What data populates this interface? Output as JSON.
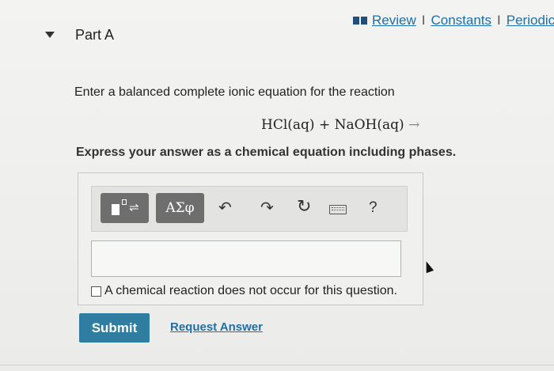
{
  "header": {
    "links": [
      "Review",
      "Constants",
      "Periodic"
    ],
    "separator": "I"
  },
  "part": {
    "title": "Part A"
  },
  "question": {
    "prompt": "Enter a balanced complete ionic equation for the reaction",
    "equation": "HCl(aq) + NaOH(aq)",
    "equation_arrow": "→",
    "instruction": "Express your answer as a chemical equation including phases."
  },
  "toolbar": {
    "greek_label": "ΑΣφ",
    "template_eq": "⇌",
    "undo_glyph": "↶",
    "redo_glyph": "↷",
    "reset_glyph": "↻",
    "help_label": "?",
    "icons": [
      "templates-icon",
      "greek-symbols-icon",
      "undo-icon",
      "redo-icon",
      "reset-icon",
      "keyboard-icon",
      "help-icon"
    ]
  },
  "answer": {
    "value": ""
  },
  "no_reaction": {
    "label": "A chemical reaction does not occur for this question.",
    "checked": false
  },
  "actions": {
    "submit_label": "Submit",
    "request_label": "Request Answer"
  },
  "colors": {
    "link": "#1f6fa5",
    "submit_bg": "#2f7ea1",
    "toolbar_button": "#6e6e6e"
  }
}
